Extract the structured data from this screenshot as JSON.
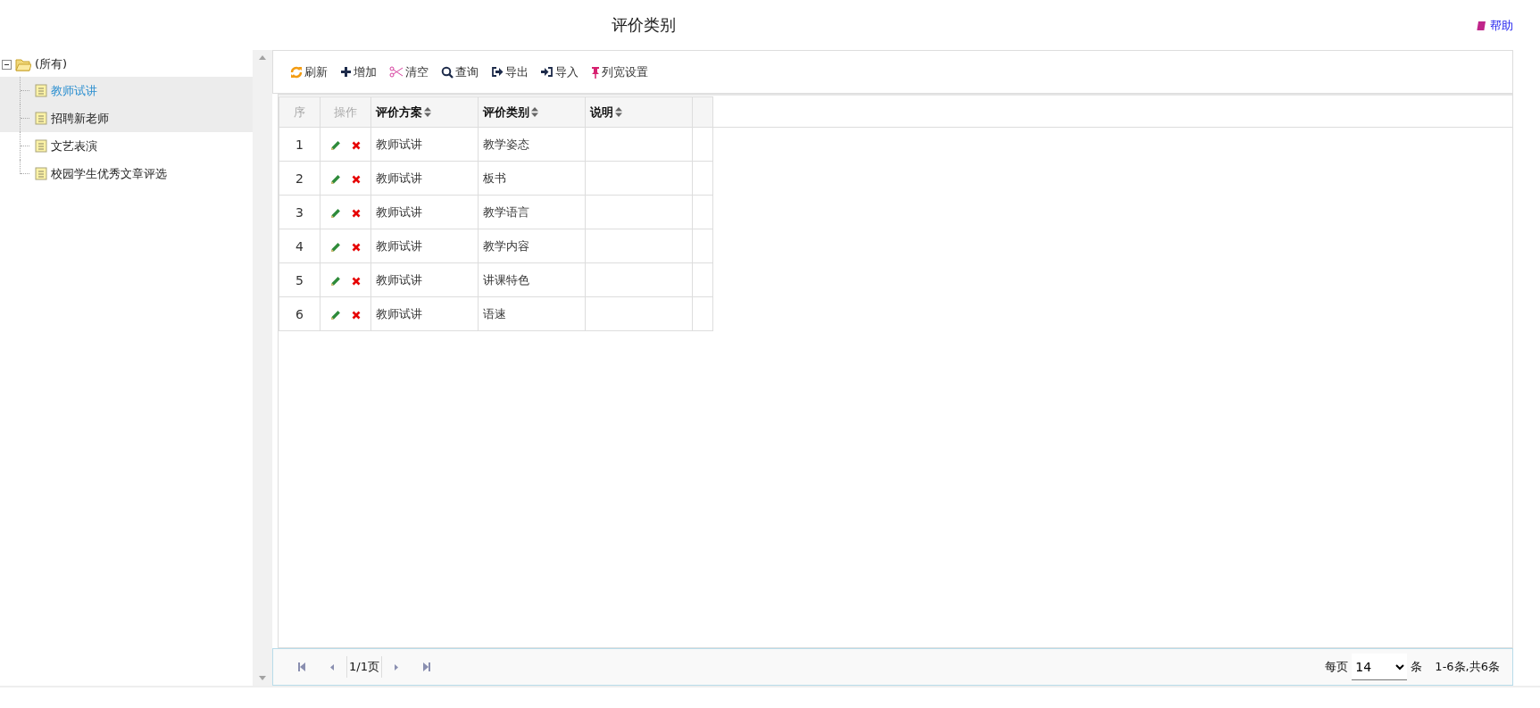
{
  "page_title": "评价类别",
  "help_link": {
    "label": "帮助"
  },
  "tree": {
    "label": "(所有)",
    "expanded": true,
    "children": [
      {
        "label": "教师试讲",
        "selected": true,
        "hovered": false
      },
      {
        "label": "招聘新老师",
        "selected": false,
        "hovered": true
      },
      {
        "label": "文艺表演",
        "selected": false,
        "hovered": false
      },
      {
        "label": "校园学生优秀文章评选",
        "selected": false,
        "hovered": false
      }
    ]
  },
  "toolbar": [
    {
      "kind": "refresh",
      "label": "刷新"
    },
    {
      "kind": "add",
      "label": "增加"
    },
    {
      "kind": "clear",
      "label": "清空"
    },
    {
      "kind": "search",
      "label": "查询"
    },
    {
      "kind": "export",
      "label": "导出"
    },
    {
      "kind": "import",
      "label": "导入"
    },
    {
      "kind": "pin",
      "label": "列宽设置"
    }
  ],
  "table": {
    "columns": [
      {
        "label": "序",
        "sortable": false
      },
      {
        "label": "操作",
        "sortable": false
      },
      {
        "label": "评价方案",
        "sortable": true
      },
      {
        "label": "评价类别",
        "sortable": true
      },
      {
        "label": "说明",
        "sortable": true
      }
    ],
    "rows": [
      {
        "index": "1",
        "plan": "教师试讲",
        "category": "教学姿态"
      },
      {
        "index": "2",
        "plan": "教师试讲",
        "category": "板书"
      },
      {
        "index": "3",
        "plan": "教师试讲",
        "category": "教学语言"
      },
      {
        "index": "4",
        "plan": "教师试讲",
        "category": "教学内容"
      },
      {
        "index": "5",
        "plan": "教师试讲",
        "category": "讲课特色"
      },
      {
        "index": "6",
        "plan": "教师试讲",
        "category": "语速"
      }
    ]
  },
  "pager": {
    "page": "1/1页",
    "per_page_label": "每页",
    "per_page": "14",
    "unit": "条",
    "summary": "1-6条,共6条"
  }
}
